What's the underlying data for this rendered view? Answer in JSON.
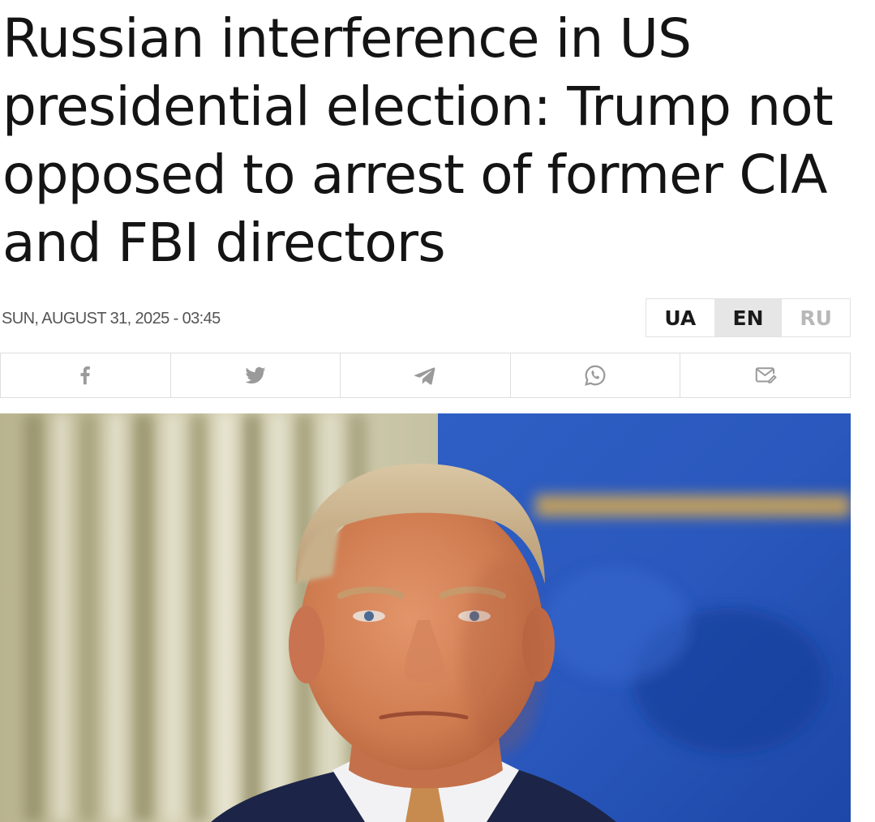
{
  "article": {
    "headline": "Russian interference in US presidential election: Trump not opposed to arrest of former CIA and FBI directors",
    "date": "SUN, AUGUST 31, 2025 - 03:45"
  },
  "languages": [
    {
      "label": "UA",
      "state": "normal"
    },
    {
      "label": "EN",
      "state": "active"
    },
    {
      "label": "RU",
      "state": "muted"
    }
  ],
  "share": {
    "icons": [
      "facebook-icon",
      "twitter-icon",
      "telegram-icon",
      "whatsapp-icon",
      "email-icon"
    ],
    "icon_color": "#9a9a9a"
  },
  "photo": {
    "subject": "portrait photo"
  },
  "colors": {
    "text": "#141414",
    "date": "#555555",
    "active_lang_bg": "#e6e6e6",
    "muted_lang": "#b8b8b8",
    "border": "#dedede"
  }
}
